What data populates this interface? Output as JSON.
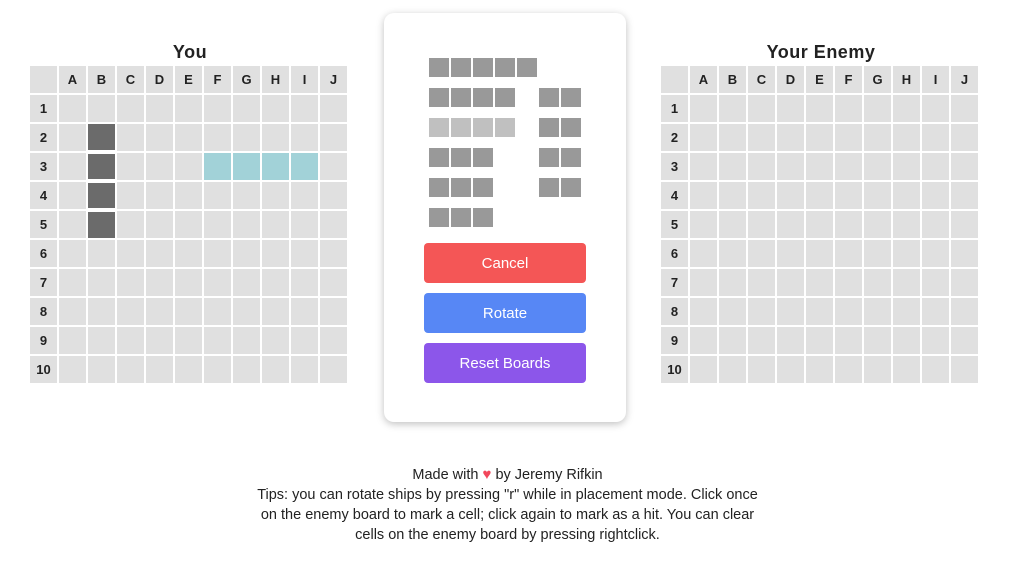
{
  "left_board": {
    "title": "You",
    "columns": [
      "A",
      "B",
      "C",
      "D",
      "E",
      "F",
      "G",
      "H",
      "I",
      "J"
    ],
    "rows": [
      "1",
      "2",
      "3",
      "4",
      "5",
      "6",
      "7",
      "8",
      "9",
      "10"
    ],
    "placed_ship_cells": [
      "B2",
      "B3",
      "B4",
      "B5"
    ],
    "preview_cells": [
      "F3",
      "G3",
      "H3",
      "I3"
    ]
  },
  "right_board": {
    "title": "Your Enemy",
    "columns": [
      "A",
      "B",
      "C",
      "D",
      "E",
      "F",
      "G",
      "H",
      "I",
      "J"
    ],
    "rows": [
      "1",
      "2",
      "3",
      "4",
      "5",
      "6",
      "7",
      "8",
      "9",
      "10"
    ]
  },
  "ship_tray": {
    "ships": [
      {
        "id": "ship-5",
        "length": 5,
        "state": "available"
      },
      {
        "id": "ship-4",
        "length": 4,
        "state": "available"
      },
      {
        "id": "ship-4b",
        "length": 4,
        "state": "placing"
      },
      {
        "id": "ship-3a",
        "length": 3,
        "state": "available"
      },
      {
        "id": "ship-3b",
        "length": 3,
        "state": "available"
      },
      {
        "id": "ship-3c",
        "length": 3,
        "state": "available"
      },
      {
        "id": "ship-2a",
        "length": 2,
        "state": "available"
      },
      {
        "id": "ship-2b",
        "length": 2,
        "state": "available"
      },
      {
        "id": "ship-2c",
        "length": 2,
        "state": "available"
      },
      {
        "id": "ship-2d",
        "length": 2,
        "state": "available"
      }
    ]
  },
  "controls": {
    "cancel_label": "Cancel",
    "rotate_label": "Rotate",
    "reset_label": "Reset Boards"
  },
  "footer": {
    "made_with": "Made with",
    "heart_icon": "heart-icon",
    "by_author": "by Jeremy Rifkin",
    "tips": "Tips: you can rotate ships by pressing \"r\" while in placement mode. Click once on the enemy board to mark a cell; click again to mark as a hit. You can clear cells on the enemy board by pressing rightclick."
  },
  "colors": {
    "ship": "#6b6b6b",
    "preview": "#a2d2d8",
    "cell": "#e0e0e0",
    "tray_ship": "#999999",
    "tray_ship_placing": "#c0c0c0",
    "cancel": "#f45656",
    "rotate": "#5787f5",
    "reset": "#8c56ea",
    "heart": "#f2475b"
  }
}
